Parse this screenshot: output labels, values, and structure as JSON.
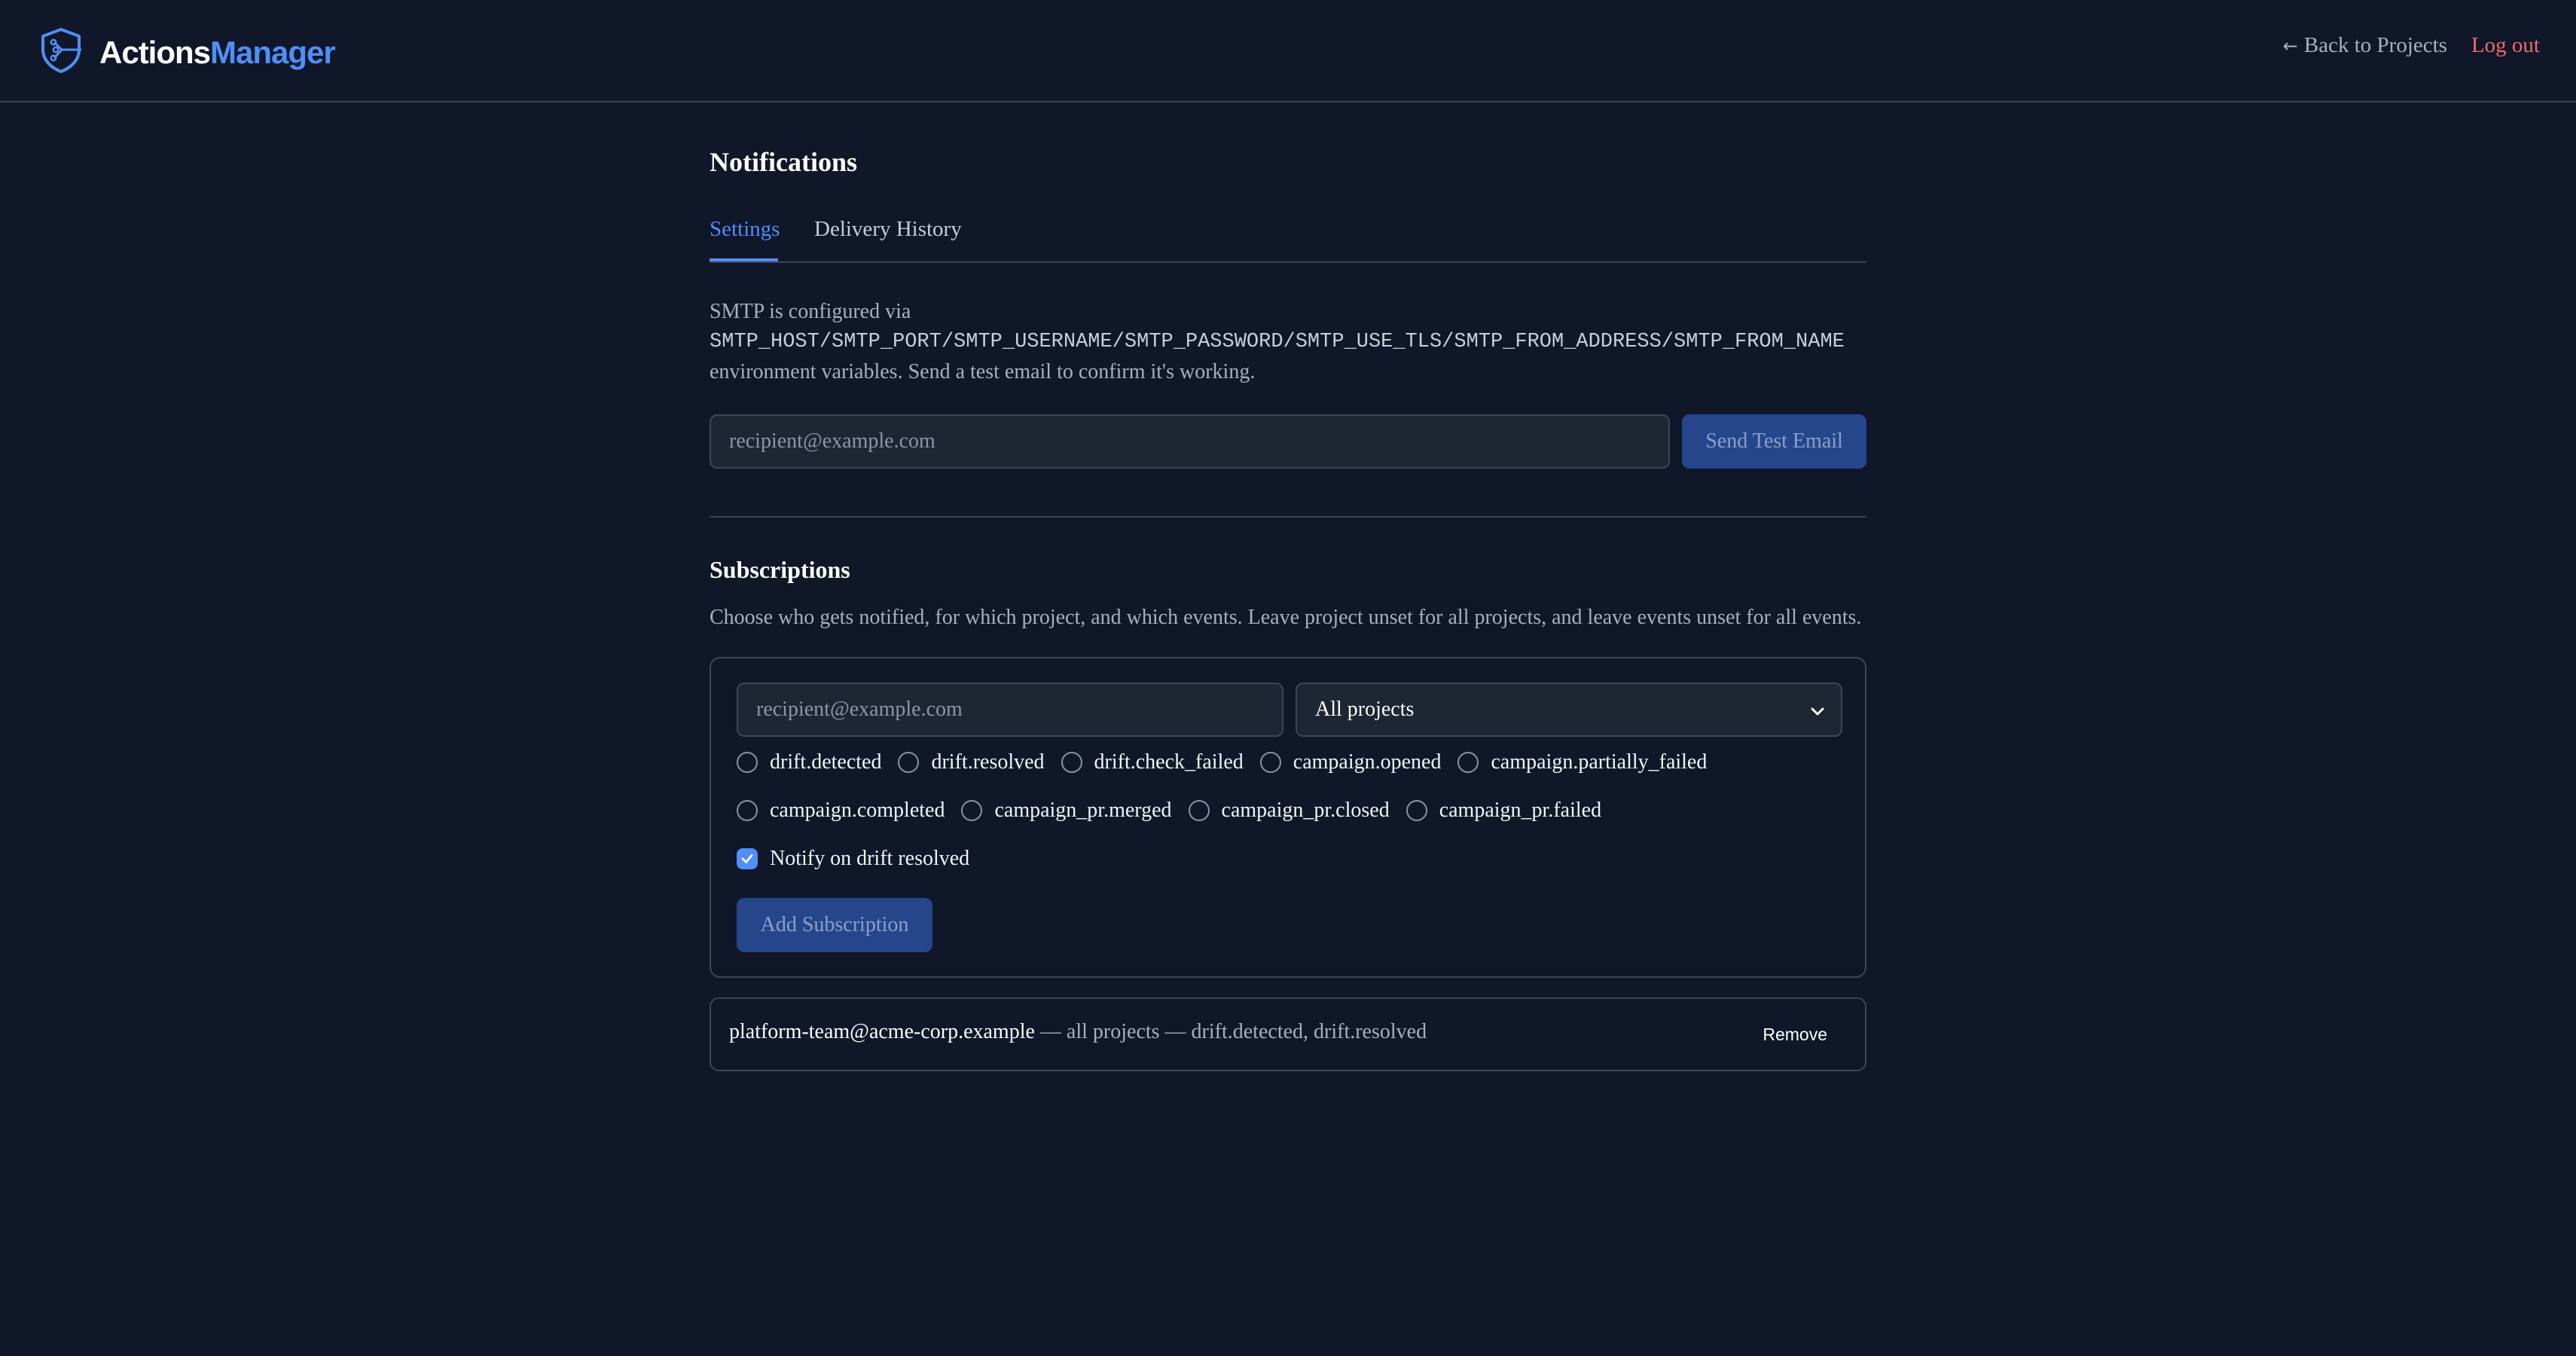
{
  "colors": {
    "background": "#0f1729",
    "accent": "#4f8ff7",
    "danger": "#f06a6a",
    "button_bg": "#26468c",
    "border": "#3d4658"
  },
  "header": {
    "brand_part1": "Actions",
    "brand_part2": "Manager",
    "logo_icon": "shield-circuit-icon",
    "back_arrow": "←",
    "back_label": "Back to Projects",
    "logout_label": "Log out"
  },
  "page": {
    "title": "Notifications",
    "tabs": [
      {
        "label": "Settings",
        "active": true
      },
      {
        "label": "Delivery History",
        "active": false
      }
    ]
  },
  "smtp": {
    "intro": "SMTP is configured via",
    "env_vars": "SMTP_HOST/SMTP_PORT/SMTP_USERNAME/SMTP_PASSWORD/SMTP_USE_TLS/SMTP_FROM_ADDRESS/SMTP_FROM_NAME",
    "outro": "environment variables. Send a test email to confirm it's working.",
    "test_input_placeholder": "recipient@example.com",
    "test_button_label": "Send Test Email"
  },
  "subscriptions": {
    "title": "Subscriptions",
    "description": "Choose who gets notified, for which project, and which events. Leave project unset for all projects, and leave events unset for all events.",
    "form": {
      "email_placeholder": "recipient@example.com",
      "project_selected": "All projects",
      "events": [
        {
          "label": "drift.detected",
          "checked": false
        },
        {
          "label": "drift.resolved",
          "checked": false
        },
        {
          "label": "drift.check_failed",
          "checked": false
        },
        {
          "label": "campaign.opened",
          "checked": false
        },
        {
          "label": "campaign.partially_failed",
          "checked": false
        },
        {
          "label": "campaign.completed",
          "checked": false
        },
        {
          "label": "campaign_pr.merged",
          "checked": false
        },
        {
          "label": "campaign_pr.closed",
          "checked": false
        },
        {
          "label": "campaign_pr.failed",
          "checked": false
        }
      ],
      "notify_resolved": {
        "label": "Notify on drift resolved",
        "checked": true
      },
      "add_button_label": "Add Subscription"
    },
    "items": [
      {
        "email": "platform-team@acme-corp.example",
        "details": " — all projects — drift.detected, drift.resolved",
        "remove_label": "Remove"
      }
    ]
  }
}
